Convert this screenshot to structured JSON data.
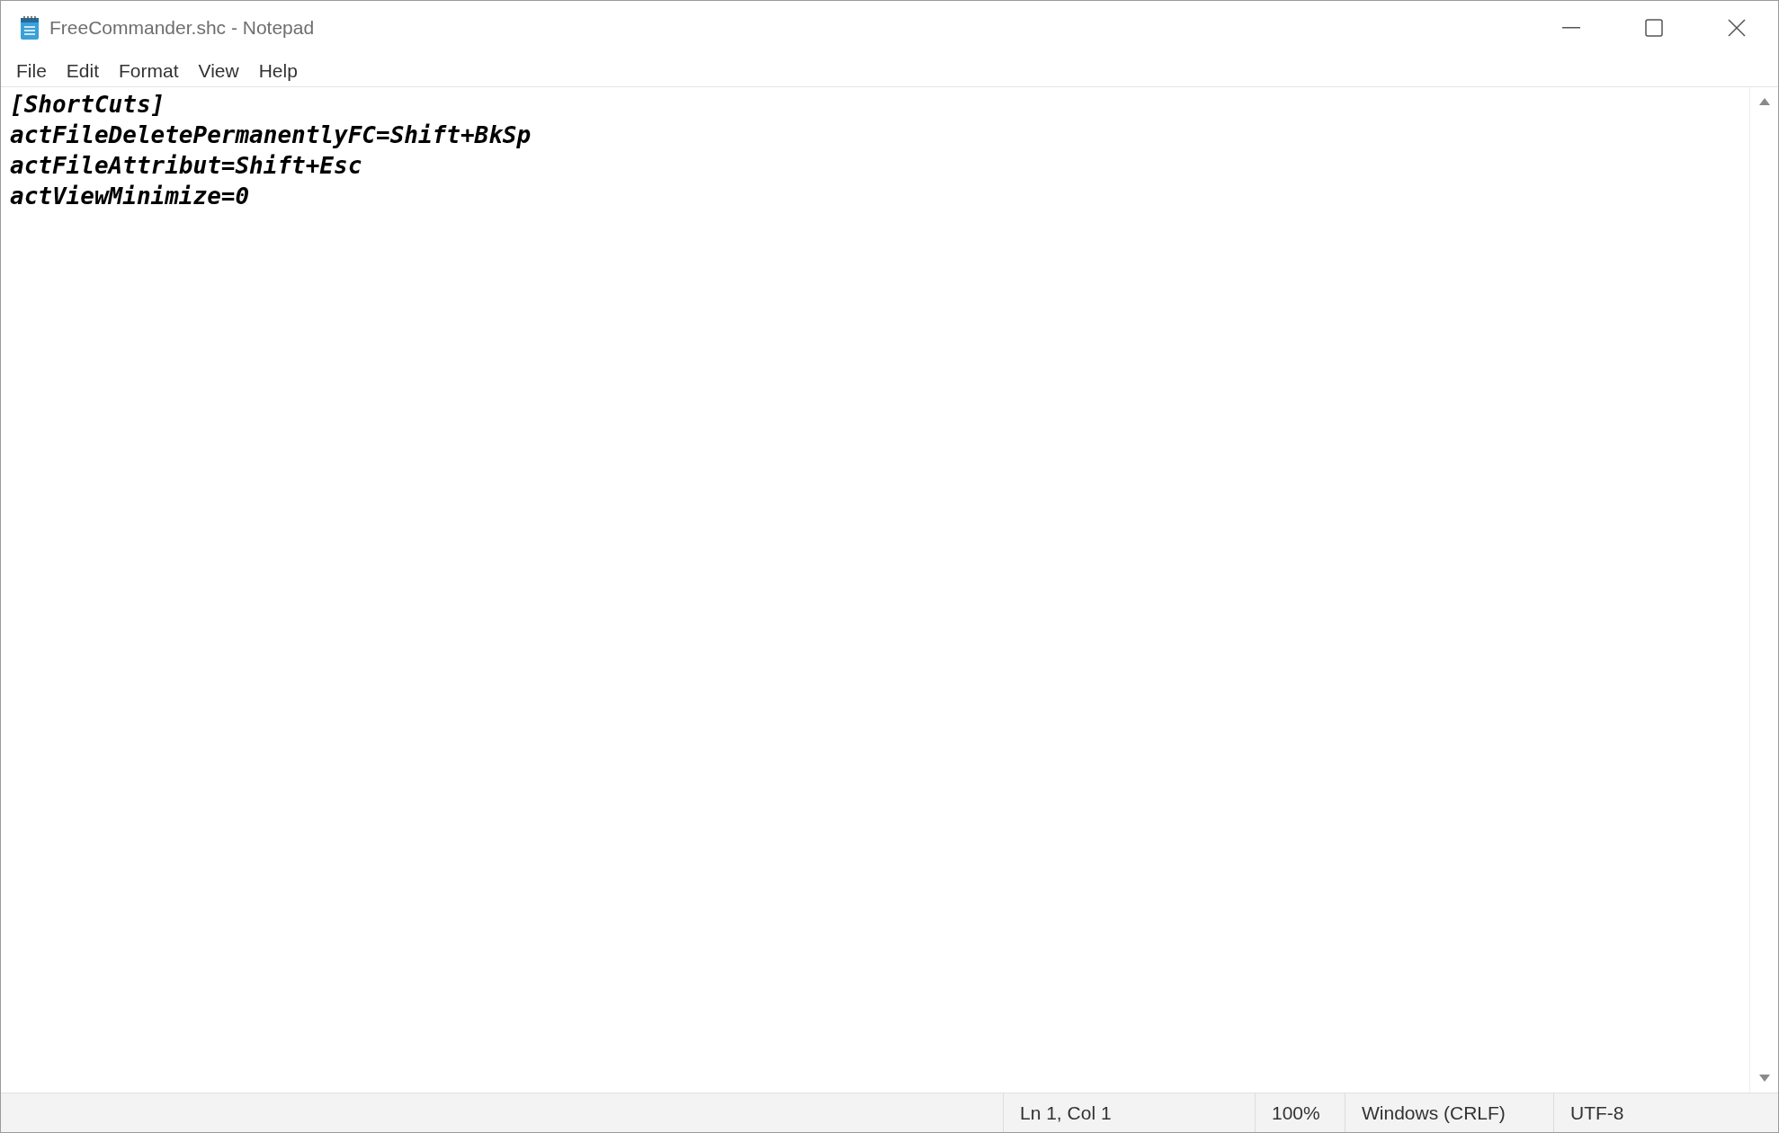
{
  "window": {
    "title": "FreeCommander.shc - Notepad"
  },
  "menu": [
    "File",
    "Edit",
    "Format",
    "View",
    "Help"
  ],
  "editor": {
    "lines": [
      "[ShortCuts]",
      "actFileDeletePermanentlyFC=Shift+BkSp",
      "actFileAttribut=Shift+Esc",
      "actViewMinimize=0"
    ]
  },
  "status_bar": [
    "Ln 1, Col 1",
    "100%",
    "Windows (CRLF)",
    "UTF-8"
  ]
}
